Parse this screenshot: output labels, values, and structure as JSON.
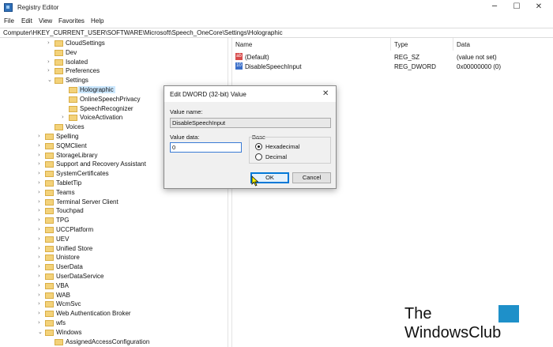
{
  "window": {
    "title": "Registry Editor",
    "icon": "registry-editor-icon"
  },
  "menu": [
    "File",
    "Edit",
    "View",
    "Favorites",
    "Help"
  ],
  "address": "Computer\\HKEY_CURRENT_USER\\SOFTWARE\\Microsoft\\Speech_OneCore\\Settings\\Holographic",
  "tree": {
    "items": [
      {
        "label": "CloudSettings",
        "chevron": "›"
      },
      {
        "label": "Dev",
        "chevron": ""
      },
      {
        "label": "Isolated",
        "chevron": "›"
      },
      {
        "label": "Preferences",
        "chevron": "›"
      },
      {
        "label": "Settings",
        "chevron": "⌄"
      },
      {
        "label": "Holographic",
        "chevron": "",
        "selected": true
      },
      {
        "label": "OnlineSpeechPrivacy",
        "chevron": ""
      },
      {
        "label": "SpeechRecognizer",
        "chevron": ""
      },
      {
        "label": "VoiceActivation",
        "chevron": "›"
      },
      {
        "label": "Voices",
        "chevron": ""
      },
      {
        "label": "Spelling",
        "chevron": "›"
      },
      {
        "label": "SQMClient",
        "chevron": "›"
      },
      {
        "label": "StorageLibrary",
        "chevron": "›"
      },
      {
        "label": "Support and Recovery Assistant",
        "chevron": "›"
      },
      {
        "label": "SystemCertificates",
        "chevron": "›"
      },
      {
        "label": "TabletTip",
        "chevron": "›"
      },
      {
        "label": "Teams",
        "chevron": "›"
      },
      {
        "label": "Terminal Server Client",
        "chevron": "›"
      },
      {
        "label": "Touchpad",
        "chevron": "›"
      },
      {
        "label": "TPG",
        "chevron": "›"
      },
      {
        "label": "UCCPlatform",
        "chevron": "›"
      },
      {
        "label": "UEV",
        "chevron": "›"
      },
      {
        "label": "Unified Store",
        "chevron": "›"
      },
      {
        "label": "Unistore",
        "chevron": "›"
      },
      {
        "label": "UserData",
        "chevron": "›"
      },
      {
        "label": "UserDataService",
        "chevron": "›"
      },
      {
        "label": "VBA",
        "chevron": "›"
      },
      {
        "label": "WAB",
        "chevron": "›"
      },
      {
        "label": "WcmSvc",
        "chevron": "›"
      },
      {
        "label": "Web Authentication Broker",
        "chevron": "›"
      },
      {
        "label": "wfs",
        "chevron": "›"
      },
      {
        "label": "Windows",
        "chevron": "⌄"
      },
      {
        "label": "AssignedAccessConfiguration",
        "chevron": ""
      }
    ]
  },
  "list": {
    "columns": {
      "name": "Name",
      "type": "Type",
      "data": "Data"
    },
    "rows": [
      {
        "icon": "ab",
        "name": "(Default)",
        "type": "REG_SZ",
        "data": "(value not set)"
      },
      {
        "icon": "10",
        "name": "DisableSpeechInput",
        "type": "REG_DWORD",
        "data": "0x00000000 (0)"
      }
    ]
  },
  "dialog": {
    "title": "Edit DWORD (32-bit) Value",
    "value_name_label": "Value name:",
    "value_name": "DisableSpeechInput",
    "value_data_label": "Value data:",
    "value_data": "0",
    "base_label": "Base",
    "hex_label": "Hexadecimal",
    "dec_label": "Decimal",
    "base_selected": "Hexadecimal",
    "ok": "OK",
    "cancel": "Cancel"
  },
  "watermark": {
    "line1": "The",
    "line2": "WindowsClub"
  },
  "colors": {
    "selection": "#cce8ff",
    "folder": "#f3d27a",
    "accent": "#0078d7"
  }
}
